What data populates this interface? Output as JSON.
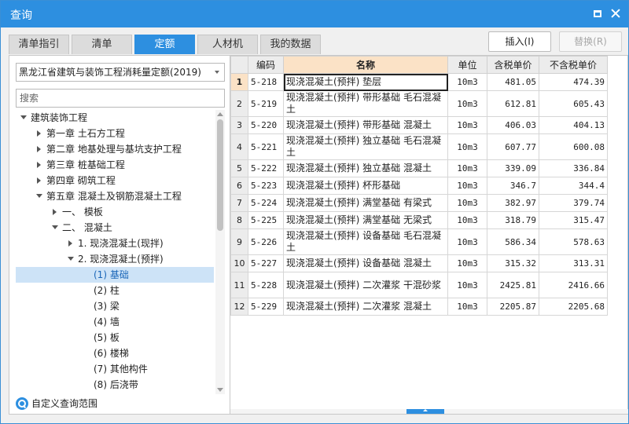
{
  "window": {
    "title": "查询"
  },
  "tabs": [
    "清单指引",
    "清单",
    "定额",
    "人材机",
    "我的数据"
  ],
  "active_tab": "定额",
  "buttons": {
    "insert": "插入(I)",
    "replace": "替换(R)"
  },
  "left": {
    "quota_library": "黑龙江省建筑与装饰工程消耗量定额(2019)",
    "search_placeholder": "搜索",
    "tree": [
      {
        "label": "建筑装饰工程",
        "level": 0,
        "toggle": "expanded"
      },
      {
        "label": "第一章 土石方工程",
        "level": 1,
        "toggle": "collapsed"
      },
      {
        "label": "第二章 地基处理与基坑支护工程",
        "level": 1,
        "toggle": "collapsed"
      },
      {
        "label": "第三章 桩基础工程",
        "level": 1,
        "toggle": "collapsed"
      },
      {
        "label": "第四章 砌筑工程",
        "level": 1,
        "toggle": "collapsed"
      },
      {
        "label": "第五章 混凝土及钢筋混凝土工程",
        "level": 1,
        "toggle": "expanded"
      },
      {
        "label": "一、 模板",
        "level": 2,
        "toggle": "collapsed"
      },
      {
        "label": "二、 混凝土",
        "level": 2,
        "toggle": "expanded"
      },
      {
        "label": "1. 现浇混凝土(现拌)",
        "level": 3,
        "toggle": "collapsed"
      },
      {
        "label": "2. 现浇混凝土(预拌)",
        "level": 3,
        "toggle": "expanded"
      },
      {
        "label": "(1) 基础",
        "level": 4,
        "toggle": "none",
        "selected": true
      },
      {
        "label": "(2) 柱",
        "level": 4,
        "toggle": "none"
      },
      {
        "label": "(3) 梁",
        "level": 4,
        "toggle": "none"
      },
      {
        "label": "(4) 墙",
        "level": 4,
        "toggle": "none"
      },
      {
        "label": "(5) 板",
        "level": 4,
        "toggle": "none"
      },
      {
        "label": "(6) 楼梯",
        "level": 4,
        "toggle": "none"
      },
      {
        "label": "(7) 其他构件",
        "level": 4,
        "toggle": "none"
      },
      {
        "label": "(8) 后浇带",
        "level": 4,
        "toggle": "none"
      }
    ],
    "custom_scope": "自定义查询范围"
  },
  "table": {
    "columns": [
      "编码",
      "名称",
      "单位",
      "含税单价",
      "不含税单价"
    ],
    "rows": [
      {
        "no": "1",
        "code": "5-218",
        "name": "现浇混凝土(预拌) 垫层",
        "unit": "10m3",
        "price_tax": "481.05",
        "price_notax": "474.39"
      },
      {
        "no": "2",
        "code": "5-219",
        "name": "现浇混凝土(预拌) 带形基础 毛石混凝土",
        "unit": "10m3",
        "price_tax": "612.81",
        "price_notax": "605.43"
      },
      {
        "no": "3",
        "code": "5-220",
        "name": "现浇混凝土(预拌) 带形基础 混凝土",
        "unit": "10m3",
        "price_tax": "406.03",
        "price_notax": "404.13"
      },
      {
        "no": "4",
        "code": "5-221",
        "name": "现浇混凝土(预拌) 独立基础 毛石混凝土",
        "unit": "10m3",
        "price_tax": "607.77",
        "price_notax": "600.08"
      },
      {
        "no": "5",
        "code": "5-222",
        "name": "现浇混凝土(预拌) 独立基础 混凝土",
        "unit": "10m3",
        "price_tax": "339.09",
        "price_notax": "336.84"
      },
      {
        "no": "6",
        "code": "5-223",
        "name": "现浇混凝土(预拌) 杯形基础",
        "unit": "10m3",
        "price_tax": "346.7",
        "price_notax": "344.4"
      },
      {
        "no": "7",
        "code": "5-224",
        "name": "现浇混凝土(预拌) 满堂基础 有梁式",
        "unit": "10m3",
        "price_tax": "382.97",
        "price_notax": "379.74"
      },
      {
        "no": "8",
        "code": "5-225",
        "name": "现浇混凝土(预拌) 满堂基础 无梁式",
        "unit": "10m3",
        "price_tax": "318.79",
        "price_notax": "315.47"
      },
      {
        "no": "9",
        "code": "5-226",
        "name": "现浇混凝土(预拌) 设备基础 毛石混凝土",
        "unit": "10m3",
        "price_tax": "586.34",
        "price_notax": "578.63"
      },
      {
        "no": "10",
        "code": "5-227",
        "name": "现浇混凝土(预拌) 设备基础 混凝土",
        "unit": "10m3",
        "price_tax": "315.32",
        "price_notax": "313.31"
      },
      {
        "no": "11",
        "code": "5-228",
        "name": "现浇混凝土(预拌) 二次灌浆 干混砂浆",
        "unit": "10m3",
        "price_tax": "2425.81",
        "price_notax": "2416.66"
      },
      {
        "no": "12",
        "code": "5-229",
        "name": "现浇混凝土(预拌) 二次灌浆 混凝土",
        "unit": "10m3",
        "price_tax": "2205.87",
        "price_notax": "2205.68"
      }
    ]
  },
  "colors": {
    "accent": "#2d8fe0",
    "header_highlight": "#fbe2c6",
    "tree_selected": "#cde3f7"
  }
}
